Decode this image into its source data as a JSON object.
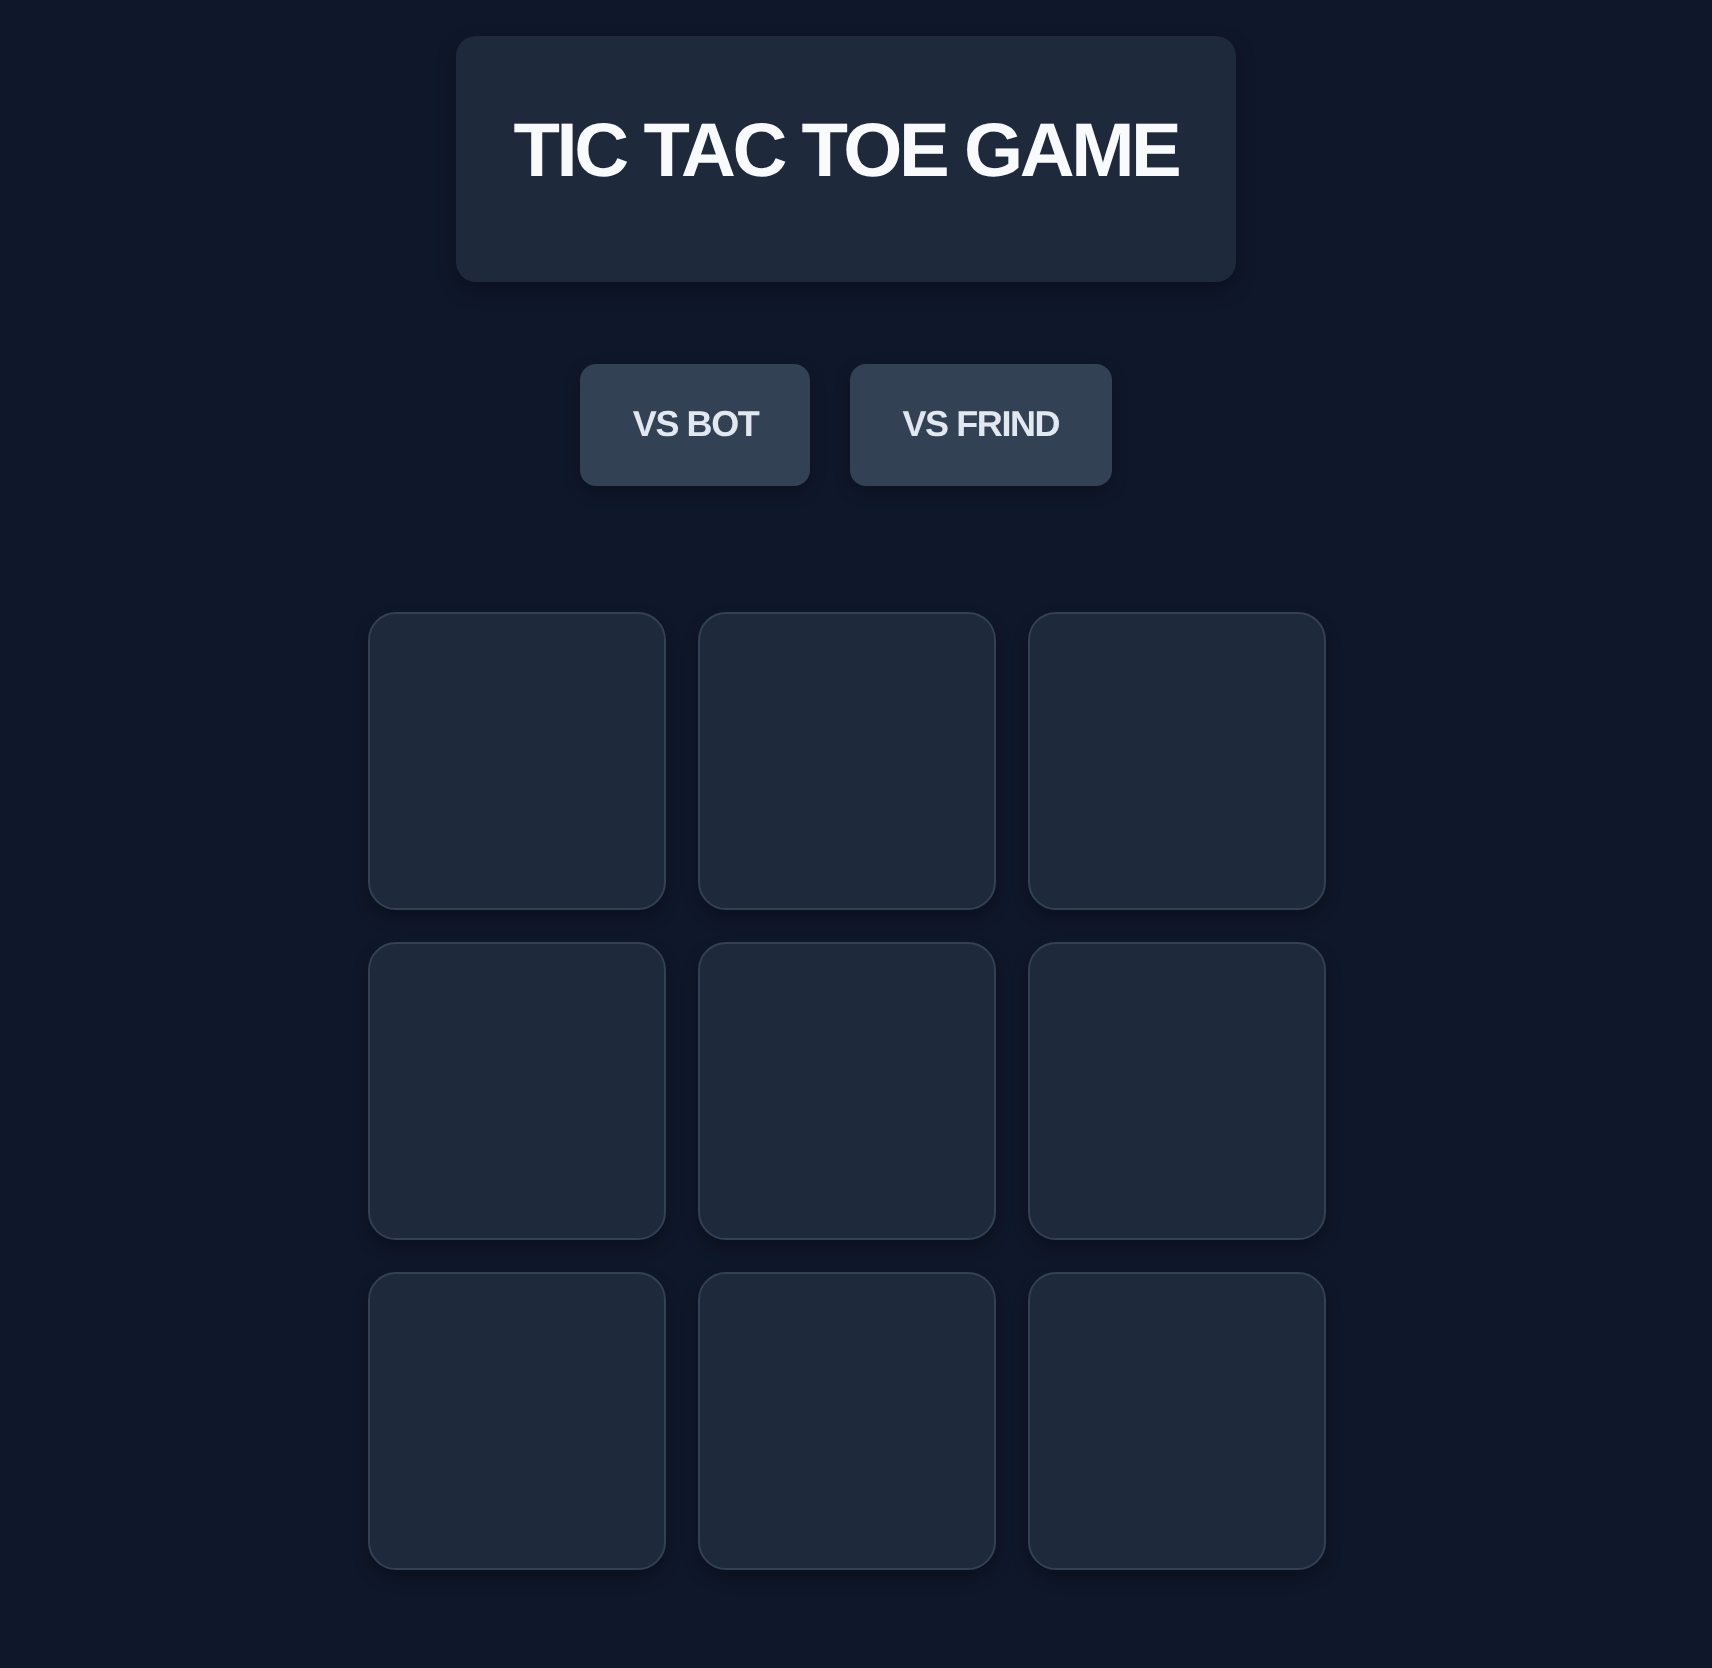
{
  "title": "TIC TAC TOE GAME",
  "modes": [
    {
      "label": "VS BOT"
    },
    {
      "label": "VS FRIND"
    }
  ]
}
